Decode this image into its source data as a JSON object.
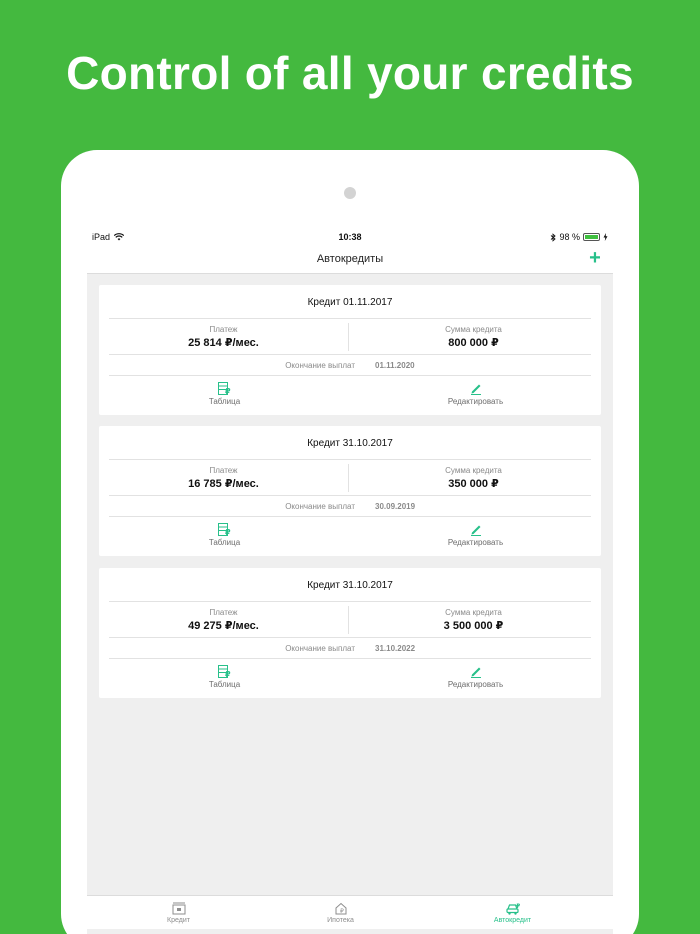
{
  "headline": "Control of all your credits",
  "status_bar": {
    "device": "iPad",
    "time": "10:38",
    "battery": "98 %",
    "battery_level": 0.98
  },
  "nav": {
    "title": "Автокредиты",
    "add_icon": "plus-icon",
    "add_label": "+"
  },
  "credits": [
    {
      "title": "Кредит 01.11.2017",
      "payment_label": "Платеж",
      "payment_value": "25 814 ₽/мес.",
      "amount_label": "Сумма кредита",
      "amount_value": "800 000 ₽",
      "end_label": "Окончание выплат",
      "end_value": "01.11.2020",
      "table_label": "Таблица",
      "edit_label": "Редактировать"
    },
    {
      "title": "Кредит 31.10.2017",
      "payment_label": "Платеж",
      "payment_value": "16 785 ₽/мес.",
      "amount_label": "Сумма кредита",
      "amount_value": "350 000 ₽",
      "end_label": "Окончание выплат",
      "end_value": "30.09.2019",
      "table_label": "Таблица",
      "edit_label": "Редактировать"
    },
    {
      "title": "Кредит 31.10.2017",
      "payment_label": "Платеж",
      "payment_value": "49 275 ₽/мес.",
      "amount_label": "Сумма кредита",
      "amount_value": "3 500 000 ₽",
      "end_label": "Окончание выплат",
      "end_value": "31.10.2022",
      "table_label": "Таблица",
      "edit_label": "Редактировать"
    }
  ],
  "tabs": [
    {
      "label": "Кредит",
      "icon": "wallet-icon",
      "active": false
    },
    {
      "label": "Ипотека",
      "icon": "house-icon",
      "active": false
    },
    {
      "label": "Автокредит",
      "icon": "car-icon",
      "active": true
    }
  ],
  "colors": {
    "background": "#44b93f",
    "accent": "#27c08a",
    "screen_bg": "#efefef"
  }
}
